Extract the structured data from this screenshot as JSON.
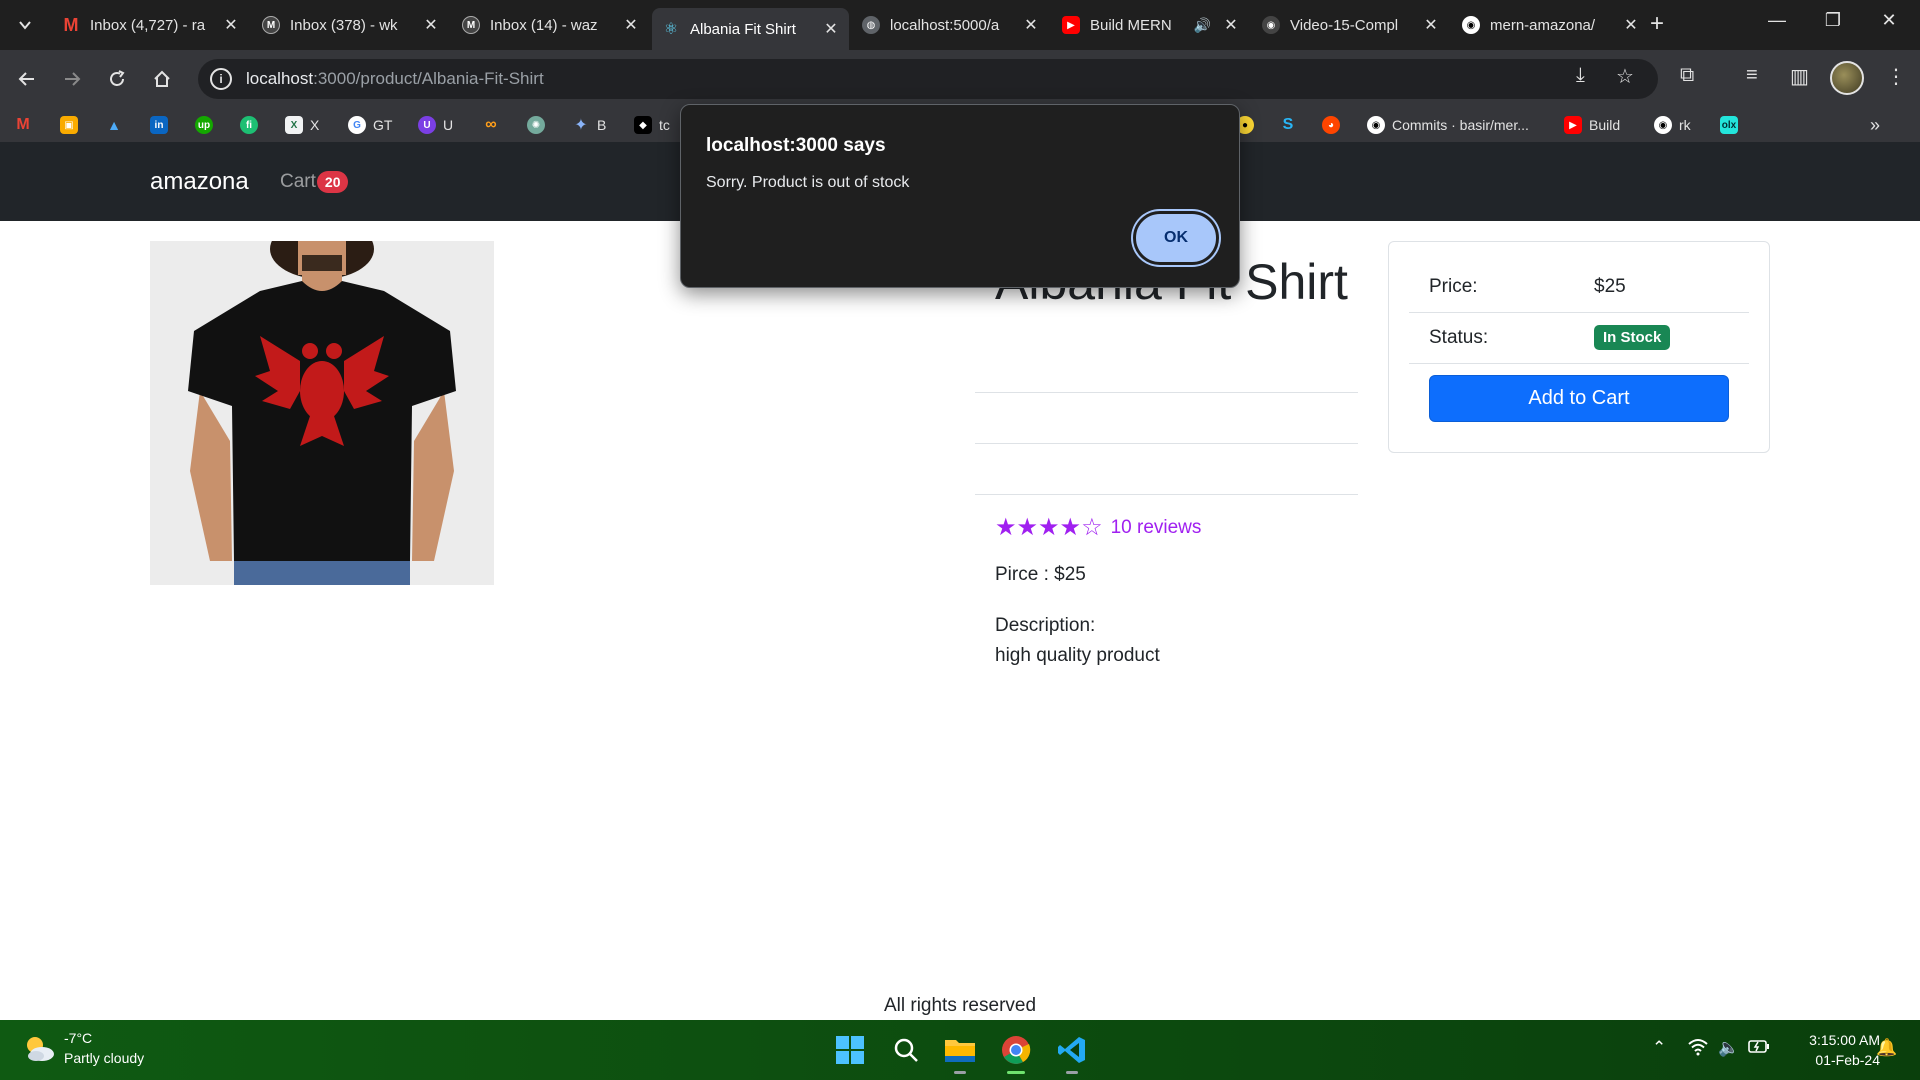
{
  "browser": {
    "tabs": [
      {
        "title": "Inbox (4,727) - ra",
        "favicon": "gmail-icon",
        "active": false
      },
      {
        "title": "Inbox (378) - wk",
        "favicon": "gmail-icon",
        "active": false
      },
      {
        "title": "Inbox (14) - waz",
        "favicon": "gmail-icon",
        "active": false
      },
      {
        "title": "Albania Fit Shirt",
        "favicon": "react-icon",
        "active": true
      },
      {
        "title": "localhost:5000/a",
        "favicon": "globe-icon",
        "active": false
      },
      {
        "title": "Build MERN",
        "favicon": "youtube-icon",
        "active": false
      },
      {
        "title": "Video-15-Compl",
        "favicon": "github-icon",
        "active": false
      },
      {
        "title": "mern-amazona/",
        "favicon": "github-icon",
        "active": false
      }
    ],
    "url_host": "localhost",
    "url_path": ":3000/product/Albania-Fit-Shirt",
    "bookmarks": [
      {
        "label": "",
        "icon": "gmail-icon"
      },
      {
        "label": "",
        "icon": "classroom-icon"
      },
      {
        "label": "",
        "icon": "drive-icon"
      },
      {
        "label": "",
        "icon": "linkedin-icon"
      },
      {
        "label": "",
        "icon": "upwork-icon"
      },
      {
        "label": "",
        "icon": "fiverr-icon"
      },
      {
        "label": "X",
        "icon": "excel-icon"
      },
      {
        "label": "GT",
        "icon": "google-icon"
      },
      {
        "label": "U",
        "icon": "u-icon"
      },
      {
        "label": "",
        "icon": "infinity-icon"
      },
      {
        "label": "",
        "icon": "chatgpt-icon"
      },
      {
        "label": "B",
        "icon": "gemini-icon"
      },
      {
        "label": "tc",
        "icon": "tc-icon"
      },
      {
        "label": "",
        "icon": "yellow-icon"
      },
      {
        "label": "",
        "icon": "s-icon"
      },
      {
        "label": "",
        "icon": "reddit-icon"
      },
      {
        "label": "Commits · basir/mer...",
        "icon": "github-icon"
      },
      {
        "label": "Build",
        "icon": "youtube-icon"
      },
      {
        "label": "rk",
        "icon": "github-icon"
      },
      {
        "label": "",
        "icon": "olx-icon"
      }
    ]
  },
  "app": {
    "brand": "amazona",
    "cart_label": "Cart",
    "cart_count": "20",
    "product": {
      "title": "Albania Fit Shirt",
      "rating": 4,
      "rating_max": 5,
      "reviews": "10 reviews",
      "price_line": "Pirce : $25",
      "description_label": "Description:",
      "description": "high quality product"
    },
    "card": {
      "price_label": "Price:",
      "price_value": "$25",
      "status_label": "Status:",
      "status_value": "In Stock",
      "add_button": "Add to Cart"
    },
    "footer": "All rights reserved"
  },
  "dialog": {
    "title": "localhost:3000 says",
    "message": "Sorry. Product is out of stock",
    "ok": "OK"
  },
  "taskbar": {
    "temperature": "-7°C",
    "weather": "Partly cloudy",
    "time": "3:15:00 AM",
    "date": "01-Feb-24"
  },
  "colors": {
    "navbar": "#212529",
    "rating": "#a020f0",
    "primary": "#0d6efd",
    "success": "#198754",
    "badge": "#dc3545"
  }
}
